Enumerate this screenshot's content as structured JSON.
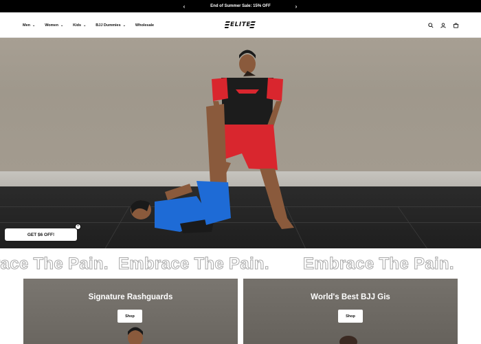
{
  "announcement": {
    "text": "End of Summer Sale: 15% OFF",
    "prev_icon": "chevron-left-icon",
    "next_icon": "chevron-right-icon"
  },
  "nav": {
    "items": [
      {
        "label": "Men",
        "has_dropdown": true
      },
      {
        "label": "Women",
        "has_dropdown": true
      },
      {
        "label": "Kids",
        "has_dropdown": true
      },
      {
        "label": "BJJ Dummies",
        "has_dropdown": true
      },
      {
        "label": "Wholesale",
        "has_dropdown": false
      }
    ]
  },
  "header": {
    "logo_text": "ELITE",
    "icons": [
      "search-icon",
      "account-icon",
      "cart-icon"
    ]
  },
  "hero": {
    "image": "two athletes grappling on a mat"
  },
  "promo": {
    "label": "GET $6 OFF!",
    "close_label": "×"
  },
  "marquee": {
    "text": "Embrace The Pain."
  },
  "collections": [
    {
      "title": "Signature Rashguards",
      "button": "Shop"
    },
    {
      "title": "World's Best BJJ Gis",
      "button": "Shop"
    }
  ],
  "colors": {
    "announcement_bg": "#000000",
    "accent_red": "#d9262e",
    "marquee_stroke": "#a8a8a8"
  }
}
